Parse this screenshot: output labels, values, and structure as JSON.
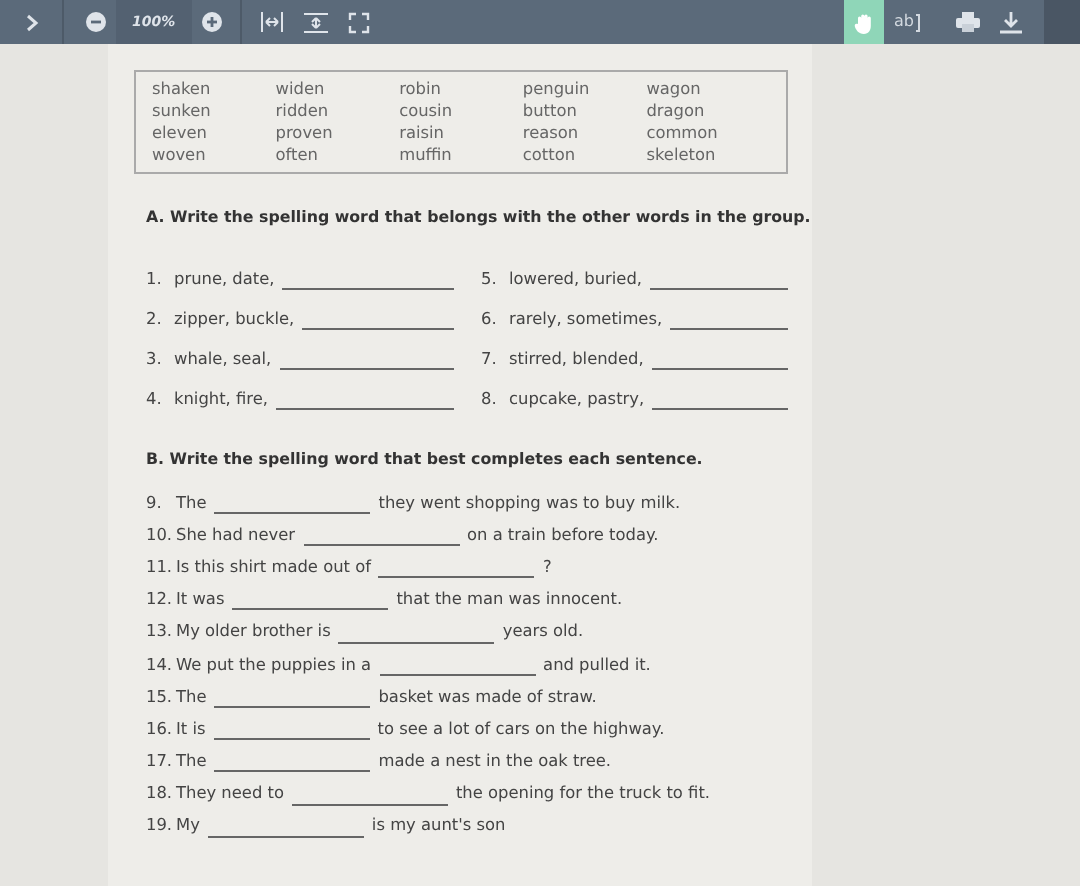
{
  "toolbar": {
    "zoom_level": "100%",
    "tools": [
      {
        "kind": "hand",
        "selected": true
      },
      {
        "kind": "text-select",
        "label": "ab",
        "selected": false
      }
    ]
  },
  "word_box": {
    "columns": [
      [
        "shaken",
        "sunken",
        "eleven",
        "woven"
      ],
      [
        "widen",
        "ridden",
        "proven",
        "often"
      ],
      [
        "robin",
        "cousin",
        "raisin",
        "muffin"
      ],
      [
        "penguin",
        "button",
        "reason",
        "cotton"
      ],
      [
        "wagon",
        "dragon",
        "common",
        "skeleton"
      ]
    ]
  },
  "section_a": {
    "heading": "A. Write the spelling word that belongs with the other words in the group.",
    "items": [
      {
        "number": "1.",
        "text": "prune, date,"
      },
      {
        "number": "2.",
        "text": "zipper, buckle,"
      },
      {
        "number": "3.",
        "text": "whale, seal,"
      },
      {
        "number": "4.",
        "text": "knight, fire,"
      },
      {
        "number": "5.",
        "text": "lowered, buried,"
      },
      {
        "number": "6.",
        "text": "rarely, sometimes,"
      },
      {
        "number": "7.",
        "text": "stirred, blended,"
      },
      {
        "number": "8.",
        "text": "cupcake, pastry,"
      }
    ]
  },
  "section_b": {
    "heading": "B. Write the spelling word that best completes each sentence.",
    "items": [
      {
        "number": "9.",
        "before": "The",
        "after": "they went shopping was to buy milk."
      },
      {
        "number": "10.",
        "before": "She had never",
        "after": "on a train before today."
      },
      {
        "number": "11.",
        "before": "Is this shirt made out of",
        "after": "?"
      },
      {
        "number": "12.",
        "before": "It was",
        "after": "that the man was innocent."
      },
      {
        "number": "13.",
        "before": "My older brother is",
        "after": "years old."
      },
      {
        "number": "14.",
        "before": "We put the puppies in a",
        "after": "and pulled it."
      },
      {
        "number": "15.",
        "before": "The",
        "after": "basket was made of straw."
      },
      {
        "number": "16.",
        "before": "It is",
        "after": "to see a lot of cars on the highway."
      },
      {
        "number": "17.",
        "before": "The",
        "after": "made a nest in the oak tree."
      },
      {
        "number": "18.",
        "before": "They need to",
        "after": "the opening for the truck to fit."
      },
      {
        "number": "19.",
        "before": "My",
        "after": "is my aunt's son"
      }
    ]
  }
}
